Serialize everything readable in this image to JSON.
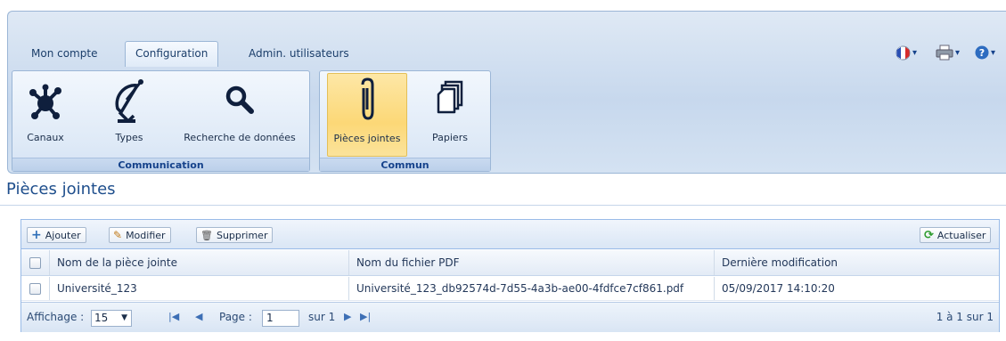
{
  "tabs": [
    {
      "label": "Mon compte"
    },
    {
      "label": "Configuration"
    },
    {
      "label": "Admin. utilisateurs"
    }
  ],
  "topright": {
    "language_icon": "france-flag-icon",
    "print_icon": "printer-icon",
    "help_icon": "help-icon"
  },
  "groups": {
    "communication": {
      "label": "Communication",
      "buttons": [
        {
          "label": "Canaux",
          "icon": "molecule-icon"
        },
        {
          "label": "Types",
          "icon": "satellite-icon"
        },
        {
          "label": "Recherche de données",
          "icon": "magnifier-icon"
        }
      ]
    },
    "commun": {
      "label": "Commun",
      "buttons": [
        {
          "label": "Pièces jointes",
          "icon": "paperclip-icon"
        },
        {
          "label": "Papiers",
          "icon": "documents-icon"
        }
      ]
    }
  },
  "page": {
    "title": "Pièces jointes"
  },
  "toolbar": {
    "add_label": "Ajouter",
    "edit_label": "Modifier",
    "delete_label": "Supprimer",
    "refresh_label": "Actualiser"
  },
  "grid": {
    "columns": [
      "Nom de la pièce jointe",
      "Nom du fichier PDF",
      "Dernière modification"
    ],
    "rows": [
      [
        "Université_123",
        "Université_123_db92574d-7d55-4a3b-ae00-4fdfce7cf861.pdf",
        "05/09/2017 14:10:20"
      ]
    ]
  },
  "pager": {
    "display_label": "Affichage :",
    "page_size": "15",
    "page_label": "Page :",
    "current_page": "1",
    "of_label": "sur 1",
    "summary": "1 à 1 sur 1"
  },
  "colors": {
    "accent": "#15428b",
    "selected": "#fcd877"
  }
}
